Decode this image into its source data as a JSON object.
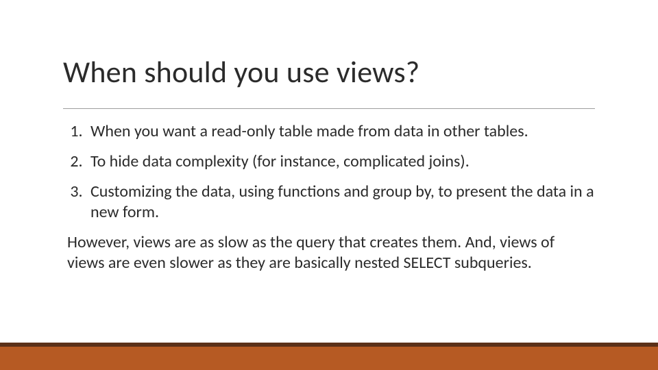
{
  "slide": {
    "title": "When should you use views?",
    "items": [
      "When you want a read-only table made from data in other tables.",
      "To hide data complexity (for instance, complicated joins).",
      "Customizing the data, using functions and group by, to present the data in a new form."
    ],
    "note": "However, views are as slow as the query that creates them. And, views of views are even slower as they are basically nested SELECT subqueries."
  },
  "colors": {
    "accent": "#b65a23",
    "accent_dark": "#5b3018"
  }
}
